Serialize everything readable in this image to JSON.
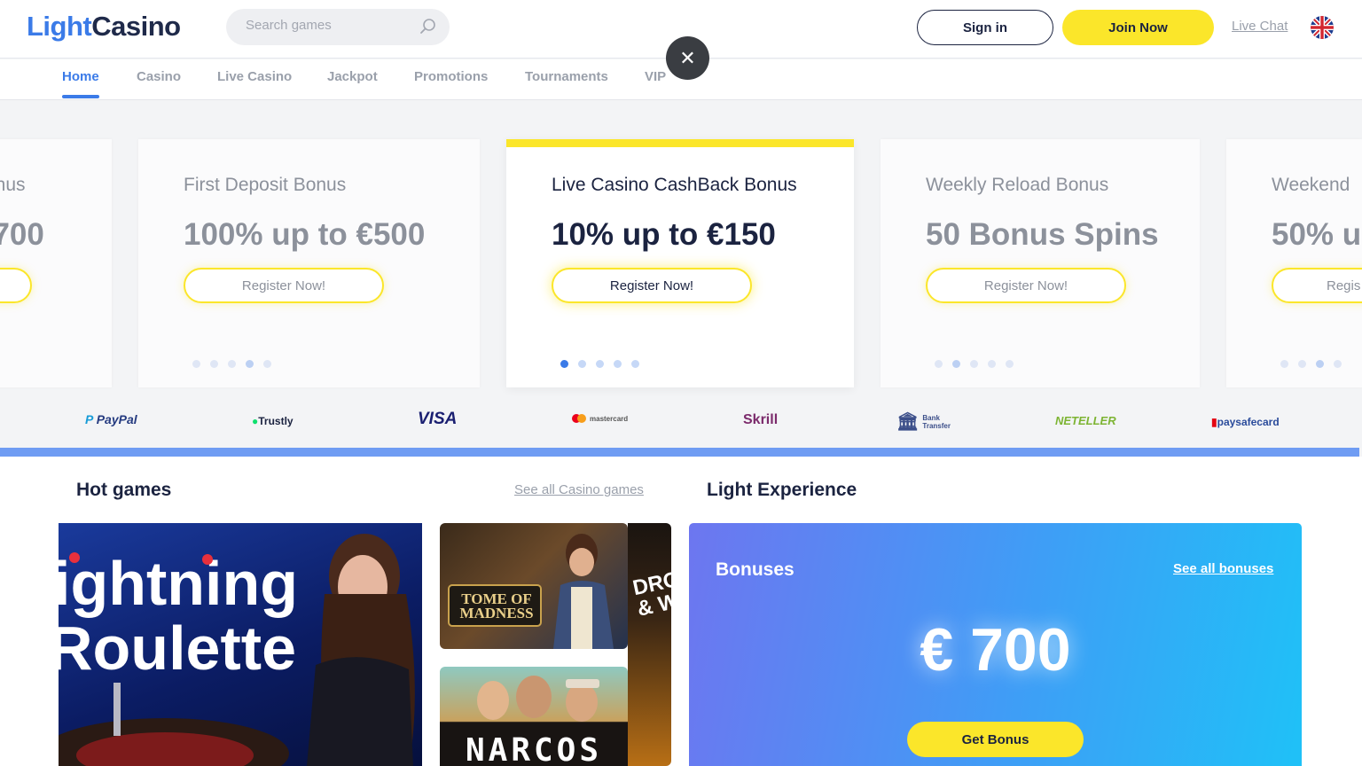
{
  "header": {
    "logo_part1": "Light",
    "logo_part2": "Casino",
    "search_placeholder": "Search games",
    "signin_label": "Sign in",
    "join_label": "Join Now",
    "livechat_label": "Live Chat",
    "language_icon": "uk-flag-icon"
  },
  "nav": {
    "items": [
      "Home",
      "Casino",
      "Live Casino",
      "Jackpot",
      "Promotions",
      "Tournaments",
      "VIP"
    ],
    "active": "Home"
  },
  "overlay": {
    "close_icon": "close-icon"
  },
  "promos": [
    {
      "title": "onus",
      "amount": "€700",
      "cta": "",
      "active_dot": 0
    },
    {
      "title": "First Deposit Bonus",
      "amount": "100% up to €500",
      "cta": "Register Now!",
      "active_dot": 3
    },
    {
      "title": "Live Casino CashBack Bonus",
      "amount": "10% up to €150",
      "cta": "Register Now!",
      "active_dot": 0
    },
    {
      "title": "Weekly Reload Bonus",
      "amount": "50 Bonus Spins",
      "cta": "Register Now!",
      "active_dot": 1
    },
    {
      "title": "Weekend",
      "amount": "50% u",
      "cta": "Regis",
      "active_dot": 2
    }
  ],
  "payments": [
    "PayPal",
    "Trustly",
    "VISA",
    "mastercard",
    "Skrill",
    "Bank Transfer",
    "NETELLER",
    "paysafecard"
  ],
  "hot_games": {
    "title": "Hot games",
    "see_all": "See all Casino games",
    "featured": {
      "line1": "ightning",
      "line2": "Roulette"
    },
    "tiles": [
      "TOME OF MADNESS",
      "DRO & W",
      "NARCOS"
    ]
  },
  "light_experience": {
    "title": "Light Experience",
    "panel_title": "Bonuses",
    "panel_link": "See all bonuses",
    "amount": "€ 700",
    "cta": "Get Bonus"
  },
  "colors": {
    "accent_blue": "#3b7be8",
    "brand_yellow": "#fbe62a",
    "text_dark": "#1b2340"
  }
}
